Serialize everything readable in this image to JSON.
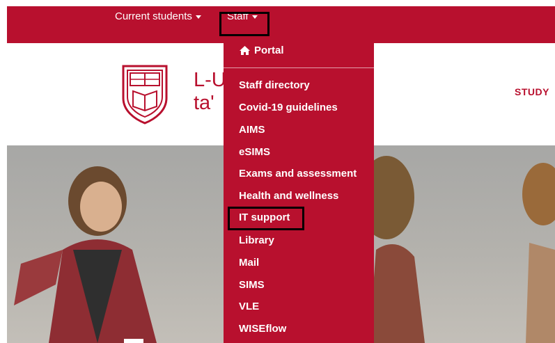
{
  "nav": {
    "current_students": "Current students",
    "staff": "Staff"
  },
  "header": {
    "uni_name": "L-U\nta'",
    "study": "STUDY"
  },
  "dropdown": {
    "portal": "Portal",
    "items": [
      "Staff directory",
      "Covid-19 guidelines",
      "AIMS",
      "eSIMS",
      "Exams and assessment",
      "Health and wellness",
      "IT support",
      "Library",
      "Mail",
      "SIMS",
      "VLE",
      "WISEflow"
    ]
  },
  "colors": {
    "brand": "#b8102e",
    "highlight": "#000000"
  },
  "icons": {
    "portal": "home-icon",
    "crest": "university-crest-icon"
  }
}
